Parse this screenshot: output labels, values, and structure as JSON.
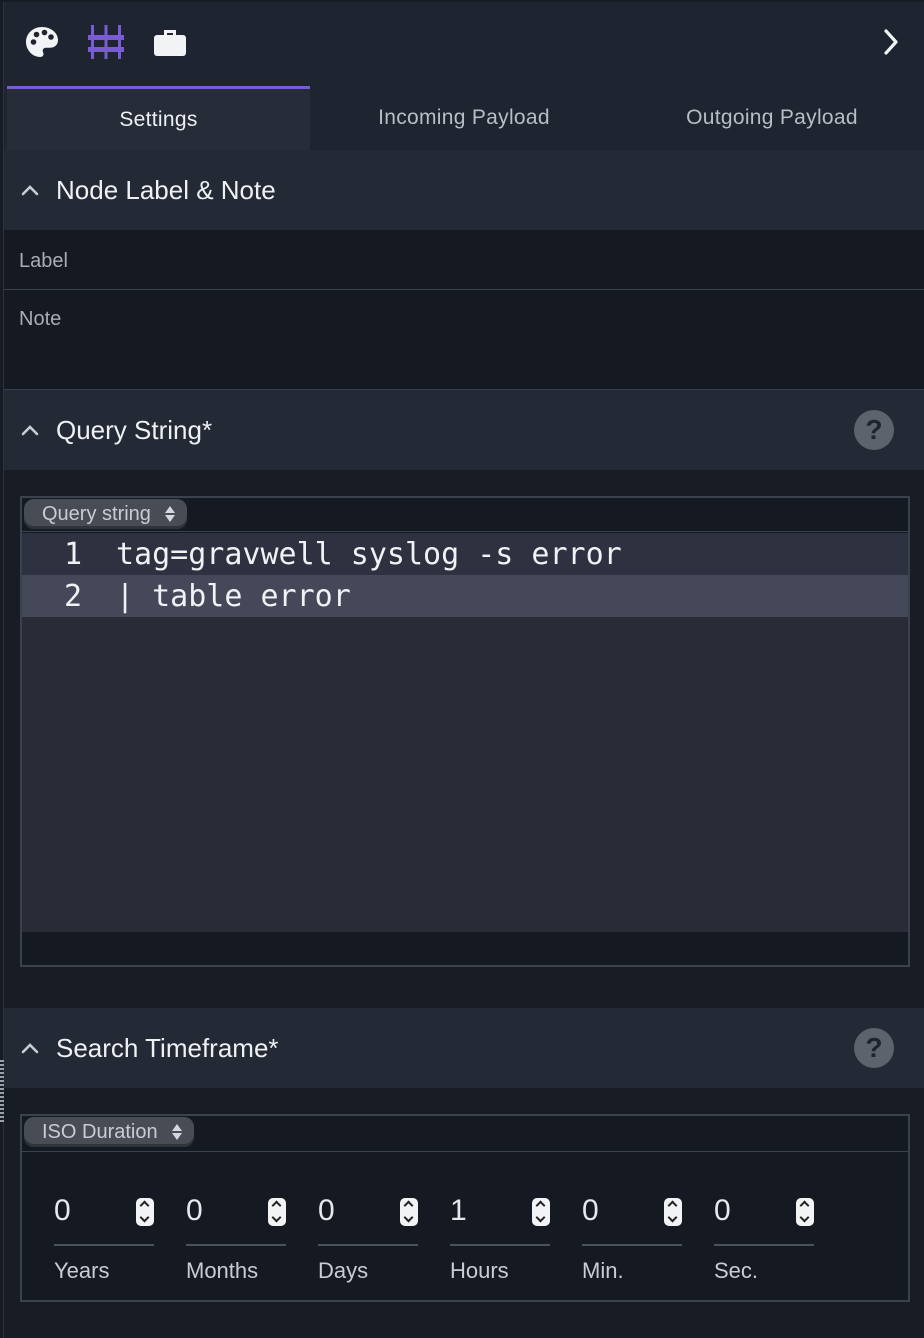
{
  "colors": {
    "accent": "#7a5bd6",
    "background": "#171c25",
    "header_bg": "#232935",
    "code_bg": "#292c37",
    "code_highlight": "#444858"
  },
  "toolbar": {
    "icons": [
      "palette-icon",
      "nodes-icon",
      "briefcase-icon",
      "chevron-right-icon"
    ]
  },
  "tabs": [
    {
      "label": "Settings",
      "active": true
    },
    {
      "label": "Incoming Payload",
      "active": false
    },
    {
      "label": "Outgoing Payload",
      "active": false
    }
  ],
  "sections": {
    "node_label": {
      "title": "Node Label & Note",
      "label_placeholder": "Label",
      "note_placeholder": "Note"
    },
    "query": {
      "title": "Query String*",
      "mode": "Query string",
      "lines": [
        {
          "number": "1",
          "text": "tag=gravwell syslog -s error"
        },
        {
          "number": "2",
          "text": "| table error"
        }
      ]
    },
    "timeframe": {
      "title": "Search Timeframe*",
      "mode": "ISO Duration",
      "fields": [
        {
          "value": "0",
          "label": "Years"
        },
        {
          "value": "0",
          "label": "Months"
        },
        {
          "value": "0",
          "label": "Days"
        },
        {
          "value": "1",
          "label": "Hours"
        },
        {
          "value": "0",
          "label": "Min."
        },
        {
          "value": "0",
          "label": "Sec."
        }
      ]
    }
  }
}
